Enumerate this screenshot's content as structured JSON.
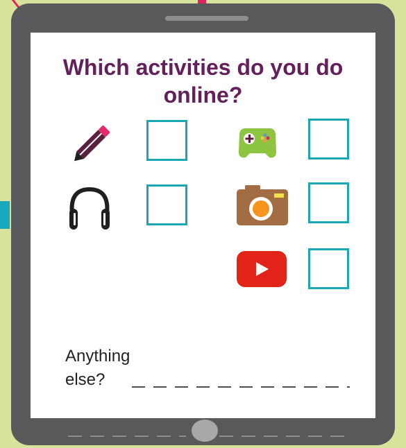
{
  "title": "Which activities do you do online?",
  "activities": [
    {
      "icon": "pencil-icon",
      "checked": false
    },
    {
      "icon": "game-controller-icon",
      "checked": false
    },
    {
      "icon": "headphones-icon",
      "checked": false
    },
    {
      "icon": "camera-icon",
      "checked": false
    },
    {
      "icon": "video-play-icon",
      "checked": false
    }
  ],
  "prompt": {
    "line1": "Anything",
    "line2": "else?"
  },
  "colors": {
    "background": "#d9e29a",
    "tablet": "#58595b",
    "title": "#63205a",
    "checkbox_border": "#1ba6b4",
    "accent_pink": "#e2225c",
    "accent_teal": "#17a8c0"
  }
}
